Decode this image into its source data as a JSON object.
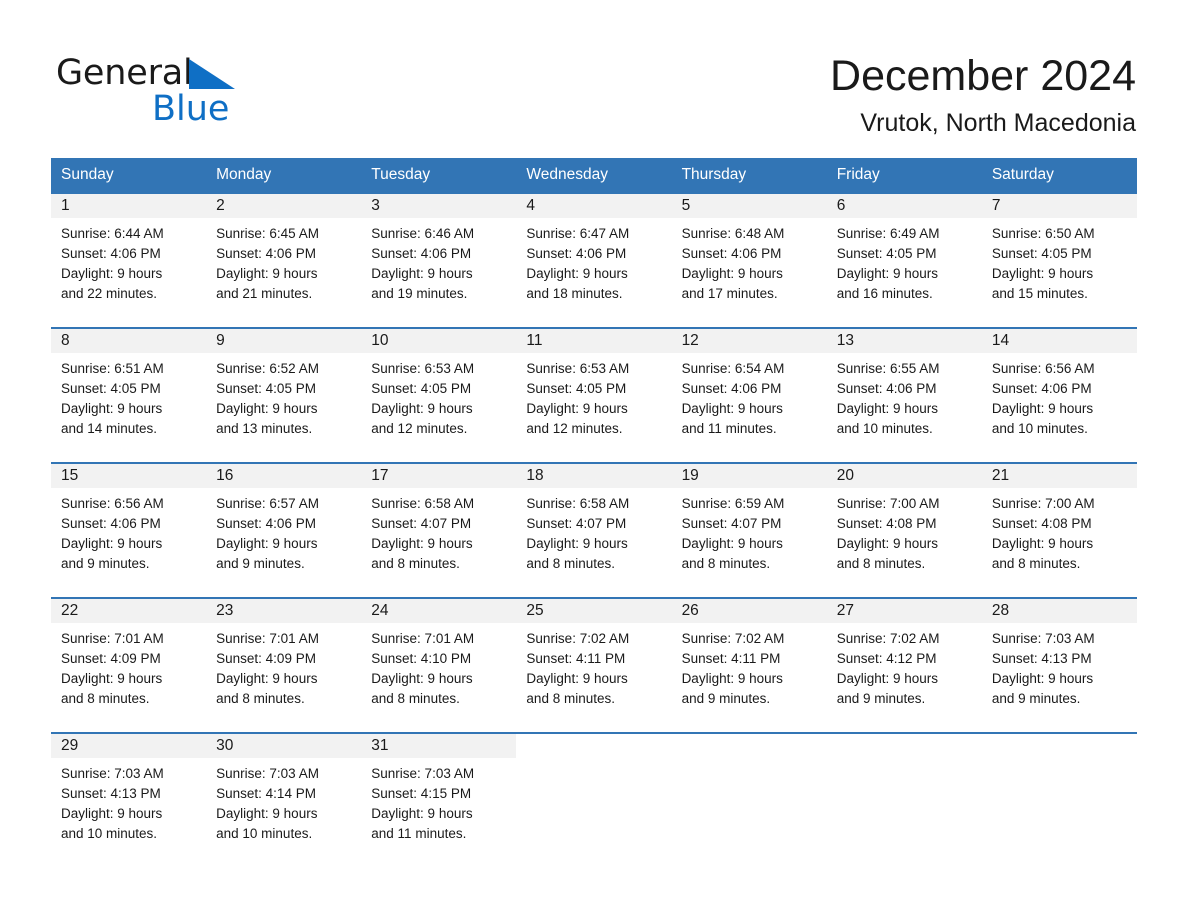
{
  "brand": {
    "name_part1": "General",
    "name_part2": "Blue",
    "triangle_icon": "triangle-icon",
    "accent_color": "#0f6fc5"
  },
  "header": {
    "title": "December 2024",
    "location": "Vrutok, North Macedonia"
  },
  "theme": {
    "header_blue": "#3275b5",
    "daynum_band": "#f2f2f2",
    "text": "#1a1a1a"
  },
  "calendar": {
    "weekday_headers": [
      "Sunday",
      "Monday",
      "Tuesday",
      "Wednesday",
      "Thursday",
      "Friday",
      "Saturday"
    ],
    "weeks": [
      [
        {
          "day": "1",
          "sunrise": "Sunrise: 6:44 AM",
          "sunset": "Sunset: 4:06 PM",
          "daylight_line1": "Daylight: 9 hours",
          "daylight_line2": "and 22 minutes."
        },
        {
          "day": "2",
          "sunrise": "Sunrise: 6:45 AM",
          "sunset": "Sunset: 4:06 PM",
          "daylight_line1": "Daylight: 9 hours",
          "daylight_line2": "and 21 minutes."
        },
        {
          "day": "3",
          "sunrise": "Sunrise: 6:46 AM",
          "sunset": "Sunset: 4:06 PM",
          "daylight_line1": "Daylight: 9 hours",
          "daylight_line2": "and 19 minutes."
        },
        {
          "day": "4",
          "sunrise": "Sunrise: 6:47 AM",
          "sunset": "Sunset: 4:06 PM",
          "daylight_line1": "Daylight: 9 hours",
          "daylight_line2": "and 18 minutes."
        },
        {
          "day": "5",
          "sunrise": "Sunrise: 6:48 AM",
          "sunset": "Sunset: 4:06 PM",
          "daylight_line1": "Daylight: 9 hours",
          "daylight_line2": "and 17 minutes."
        },
        {
          "day": "6",
          "sunrise": "Sunrise: 6:49 AM",
          "sunset": "Sunset: 4:05 PM",
          "daylight_line1": "Daylight: 9 hours",
          "daylight_line2": "and 16 minutes."
        },
        {
          "day": "7",
          "sunrise": "Sunrise: 6:50 AM",
          "sunset": "Sunset: 4:05 PM",
          "daylight_line1": "Daylight: 9 hours",
          "daylight_line2": "and 15 minutes."
        }
      ],
      [
        {
          "day": "8",
          "sunrise": "Sunrise: 6:51 AM",
          "sunset": "Sunset: 4:05 PM",
          "daylight_line1": "Daylight: 9 hours",
          "daylight_line2": "and 14 minutes."
        },
        {
          "day": "9",
          "sunrise": "Sunrise: 6:52 AM",
          "sunset": "Sunset: 4:05 PM",
          "daylight_line1": "Daylight: 9 hours",
          "daylight_line2": "and 13 minutes."
        },
        {
          "day": "10",
          "sunrise": "Sunrise: 6:53 AM",
          "sunset": "Sunset: 4:05 PM",
          "daylight_line1": "Daylight: 9 hours",
          "daylight_line2": "and 12 minutes."
        },
        {
          "day": "11",
          "sunrise": "Sunrise: 6:53 AM",
          "sunset": "Sunset: 4:05 PM",
          "daylight_line1": "Daylight: 9 hours",
          "daylight_line2": "and 12 minutes."
        },
        {
          "day": "12",
          "sunrise": "Sunrise: 6:54 AM",
          "sunset": "Sunset: 4:06 PM",
          "daylight_line1": "Daylight: 9 hours",
          "daylight_line2": "and 11 minutes."
        },
        {
          "day": "13",
          "sunrise": "Sunrise: 6:55 AM",
          "sunset": "Sunset: 4:06 PM",
          "daylight_line1": "Daylight: 9 hours",
          "daylight_line2": "and 10 minutes."
        },
        {
          "day": "14",
          "sunrise": "Sunrise: 6:56 AM",
          "sunset": "Sunset: 4:06 PM",
          "daylight_line1": "Daylight: 9 hours",
          "daylight_line2": "and 10 minutes."
        }
      ],
      [
        {
          "day": "15",
          "sunrise": "Sunrise: 6:56 AM",
          "sunset": "Sunset: 4:06 PM",
          "daylight_line1": "Daylight: 9 hours",
          "daylight_line2": "and 9 minutes."
        },
        {
          "day": "16",
          "sunrise": "Sunrise: 6:57 AM",
          "sunset": "Sunset: 4:06 PM",
          "daylight_line1": "Daylight: 9 hours",
          "daylight_line2": "and 9 minutes."
        },
        {
          "day": "17",
          "sunrise": "Sunrise: 6:58 AM",
          "sunset": "Sunset: 4:07 PM",
          "daylight_line1": "Daylight: 9 hours",
          "daylight_line2": "and 8 minutes."
        },
        {
          "day": "18",
          "sunrise": "Sunrise: 6:58 AM",
          "sunset": "Sunset: 4:07 PM",
          "daylight_line1": "Daylight: 9 hours",
          "daylight_line2": "and 8 minutes."
        },
        {
          "day": "19",
          "sunrise": "Sunrise: 6:59 AM",
          "sunset": "Sunset: 4:07 PM",
          "daylight_line1": "Daylight: 9 hours",
          "daylight_line2": "and 8 minutes."
        },
        {
          "day": "20",
          "sunrise": "Sunrise: 7:00 AM",
          "sunset": "Sunset: 4:08 PM",
          "daylight_line1": "Daylight: 9 hours",
          "daylight_line2": "and 8 minutes."
        },
        {
          "day": "21",
          "sunrise": "Sunrise: 7:00 AM",
          "sunset": "Sunset: 4:08 PM",
          "daylight_line1": "Daylight: 9 hours",
          "daylight_line2": "and 8 minutes."
        }
      ],
      [
        {
          "day": "22",
          "sunrise": "Sunrise: 7:01 AM",
          "sunset": "Sunset: 4:09 PM",
          "daylight_line1": "Daylight: 9 hours",
          "daylight_line2": "and 8 minutes."
        },
        {
          "day": "23",
          "sunrise": "Sunrise: 7:01 AM",
          "sunset": "Sunset: 4:09 PM",
          "daylight_line1": "Daylight: 9 hours",
          "daylight_line2": "and 8 minutes."
        },
        {
          "day": "24",
          "sunrise": "Sunrise: 7:01 AM",
          "sunset": "Sunset: 4:10 PM",
          "daylight_line1": "Daylight: 9 hours",
          "daylight_line2": "and 8 minutes."
        },
        {
          "day": "25",
          "sunrise": "Sunrise: 7:02 AM",
          "sunset": "Sunset: 4:11 PM",
          "daylight_line1": "Daylight: 9 hours",
          "daylight_line2": "and 8 minutes."
        },
        {
          "day": "26",
          "sunrise": "Sunrise: 7:02 AM",
          "sunset": "Sunset: 4:11 PM",
          "daylight_line1": "Daylight: 9 hours",
          "daylight_line2": "and 9 minutes."
        },
        {
          "day": "27",
          "sunrise": "Sunrise: 7:02 AM",
          "sunset": "Sunset: 4:12 PM",
          "daylight_line1": "Daylight: 9 hours",
          "daylight_line2": "and 9 minutes."
        },
        {
          "day": "28",
          "sunrise": "Sunrise: 7:03 AM",
          "sunset": "Sunset: 4:13 PM",
          "daylight_line1": "Daylight: 9 hours",
          "daylight_line2": "and 9 minutes."
        }
      ],
      [
        {
          "day": "29",
          "sunrise": "Sunrise: 7:03 AM",
          "sunset": "Sunset: 4:13 PM",
          "daylight_line1": "Daylight: 9 hours",
          "daylight_line2": "and 10 minutes."
        },
        {
          "day": "30",
          "sunrise": "Sunrise: 7:03 AM",
          "sunset": "Sunset: 4:14 PM",
          "daylight_line1": "Daylight: 9 hours",
          "daylight_line2": "and 10 minutes."
        },
        {
          "day": "31",
          "sunrise": "Sunrise: 7:03 AM",
          "sunset": "Sunset: 4:15 PM",
          "daylight_line1": "Daylight: 9 hours",
          "daylight_line2": "and 11 minutes."
        },
        {
          "day": "",
          "sunrise": "",
          "sunset": "",
          "daylight_line1": "",
          "daylight_line2": ""
        },
        {
          "day": "",
          "sunrise": "",
          "sunset": "",
          "daylight_line1": "",
          "daylight_line2": ""
        },
        {
          "day": "",
          "sunrise": "",
          "sunset": "",
          "daylight_line1": "",
          "daylight_line2": ""
        },
        {
          "day": "",
          "sunrise": "",
          "sunset": "",
          "daylight_line1": "",
          "daylight_line2": ""
        }
      ]
    ]
  }
}
